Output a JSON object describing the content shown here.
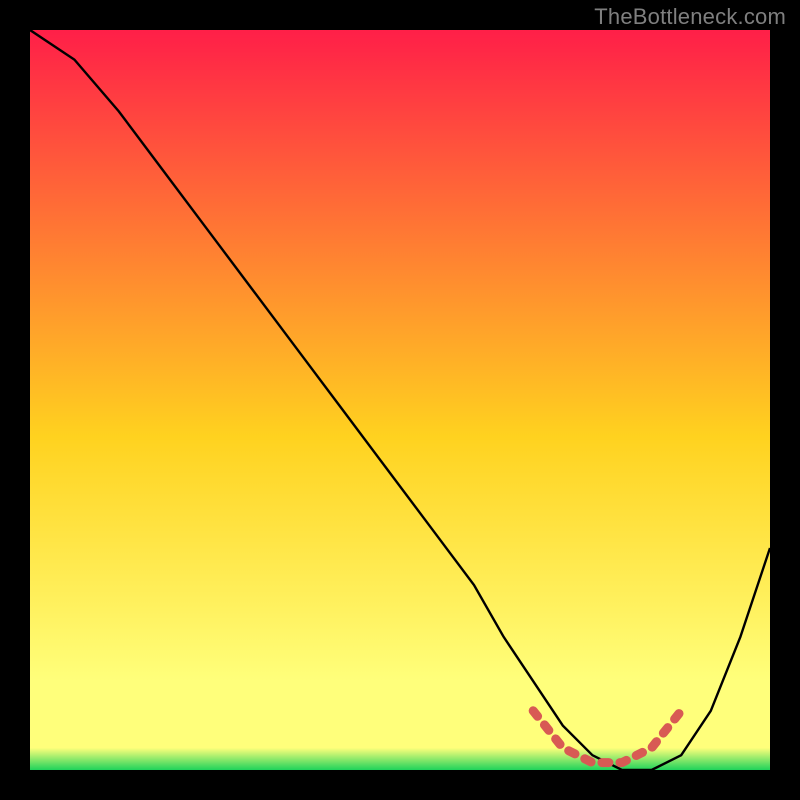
{
  "watermark": "TheBottleneck.com",
  "colors": {
    "bg": "#000000",
    "grad_top": "#ff1f48",
    "grad_mid": "#ffd21f",
    "grad_low": "#ffff7b",
    "grad_bottom": "#1fd35b",
    "curve": "#000000",
    "highlight": "#d85a54"
  },
  "chart_data": {
    "type": "line",
    "title": "",
    "xlabel": "",
    "ylabel": "",
    "xlim": [
      0,
      100
    ],
    "ylim": [
      0,
      100
    ],
    "series": [
      {
        "name": "curve",
        "x": [
          0,
          6,
          12,
          18,
          24,
          30,
          36,
          42,
          48,
          54,
          60,
          64,
          68,
          72,
          76,
          80,
          84,
          88,
          92,
          96,
          100
        ],
        "values": [
          100,
          96,
          89,
          81,
          73,
          65,
          57,
          49,
          41,
          33,
          25,
          18,
          12,
          6,
          2,
          0,
          0,
          2,
          8,
          18,
          30
        ]
      }
    ],
    "annotations": [
      {
        "name": "highlight",
        "x": [
          68,
          72,
          76,
          80,
          84,
          88
        ],
        "values": [
          8,
          3,
          1,
          1,
          3,
          8
        ]
      }
    ]
  }
}
